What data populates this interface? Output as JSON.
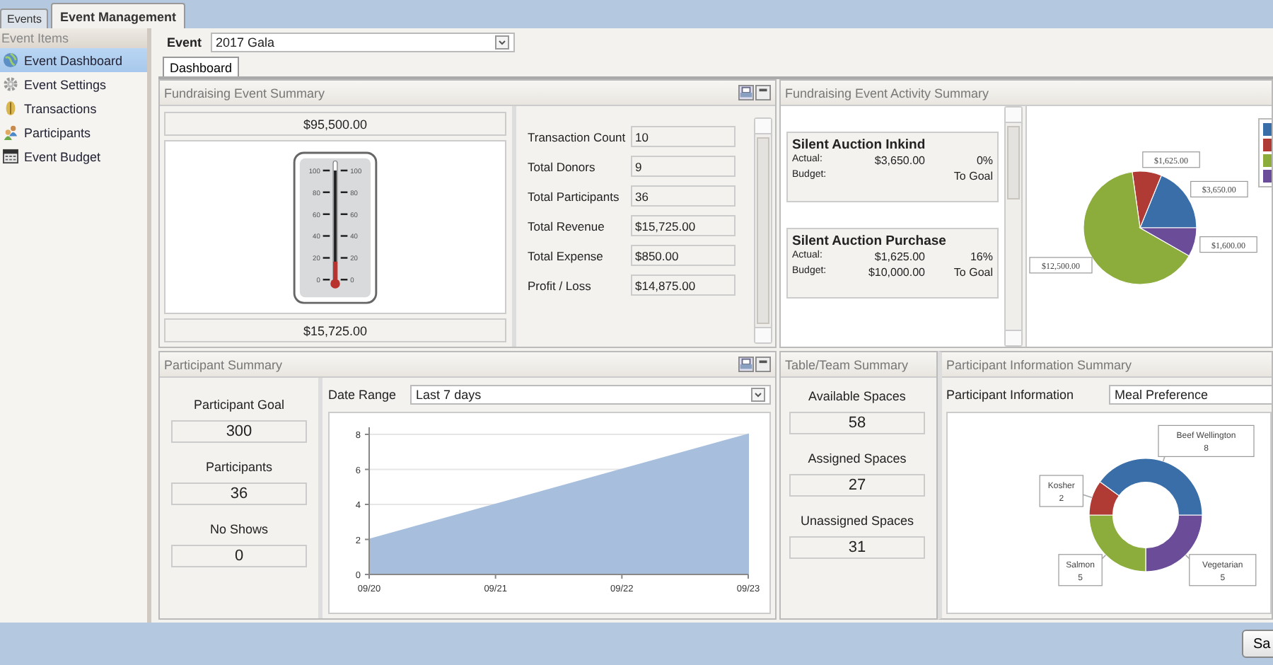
{
  "top_tabs": [
    {
      "label": "Events",
      "selected": false
    },
    {
      "label": "Event Management",
      "selected": true
    }
  ],
  "sidebar": {
    "title": "Event Items",
    "items": [
      {
        "label": "Event Dashboard",
        "kind": "globe",
        "selected": true
      },
      {
        "label": "Event Settings",
        "kind": "gear",
        "selected": false
      },
      {
        "label": "Transactions",
        "kind": "coin",
        "selected": false
      },
      {
        "label": "Participants",
        "kind": "people",
        "selected": false
      },
      {
        "label": "Event Budget",
        "kind": "calendar",
        "selected": false
      }
    ]
  },
  "event": {
    "label": "Event",
    "value": "2017 Gala"
  },
  "view_tabs": [
    {
      "label": "Dashboard",
      "selected": true
    }
  ],
  "fundraising_summary": {
    "title": "Fundraising Event Summary",
    "goal": "$95,500.00",
    "raised": "$15,725.00",
    "thermometer": {
      "level": 0.165,
      "left_ticks": [
        "100",
        "80",
        "60",
        "40",
        "20",
        "0"
      ],
      "right_ticks": [
        "100",
        "80",
        "60",
        "40",
        "20",
        "0"
      ]
    },
    "stats": [
      {
        "label": "Transaction Count",
        "value": "10"
      },
      {
        "label": "Total Donors",
        "value": "9"
      },
      {
        "label": "Total Participants",
        "value": "36"
      },
      {
        "label": "Total Revenue",
        "value": "$15,725.00"
      },
      {
        "label": "Total Expense",
        "value": "$850.00"
      },
      {
        "label": "Profit / Loss",
        "value": "$14,875.00"
      }
    ]
  },
  "activity_summary": {
    "title": "Fundraising Event Activity Summary",
    "cards": [
      {
        "title": "Silent Auction Inkind",
        "actual_label": "Actual:",
        "actual": "$3,650.00",
        "percent": "0%",
        "budget_label": "Budget:",
        "goal_label": "To Goal"
      },
      {
        "title": "Silent Auction Purchase",
        "actual_label": "Actual:",
        "actual": "$1,625.00",
        "percent": "16%",
        "budget_label": "Budget:",
        "budget": "$10,000.00",
        "goal_label": "To Goal"
      }
    ],
    "chart_data": {
      "type": "pie",
      "values": [
        3650,
        1625,
        12500,
        1600
      ],
      "value_labels": [
        "$3,650.00",
        "$1,625.00",
        "$12,500.00",
        "$1,600.00"
      ],
      "colors": [
        "#3a6ea8",
        "#b03a34",
        "#8cac3c",
        "#6a4c98"
      ],
      "data_labels": true
    }
  },
  "participant_summary": {
    "title": "Participant Summary",
    "stats": [
      {
        "label": "Participant Goal",
        "value": "300"
      },
      {
        "label": "Participants",
        "value": "36"
      },
      {
        "label": "No Shows",
        "value": "0"
      }
    ],
    "date_range": {
      "label": "Date Range",
      "value": "Last 7 days"
    },
    "chart_data": {
      "type": "area",
      "x": [
        "09/20",
        "09/21",
        "09/22",
        "09/23"
      ],
      "series": [
        {
          "color": "#a7bfdd",
          "values": [
            2,
            4,
            6,
            8
          ]
        }
      ],
      "ylim": [
        0,
        8
      ],
      "yticks": [
        0,
        2,
        4,
        6,
        8
      ],
      "grid": true
    }
  },
  "table_team_summary": {
    "title": "Table/Team Summary",
    "stats": [
      {
        "label": "Available Spaces",
        "value": "58"
      },
      {
        "label": "Assigned Spaces",
        "value": "27"
      },
      {
        "label": "Unassigned Spaces",
        "value": "31"
      }
    ]
  },
  "participant_information_summary": {
    "title": "Participant Information Summary",
    "field": {
      "label": "Participant Information",
      "value": "Meal Preference"
    },
    "chart_data": {
      "type": "donut",
      "categories": [
        "Vegetarian",
        "Salmon",
        "Kosher",
        "Beef Wellington"
      ],
      "values": [
        5,
        5,
        2,
        8
      ],
      "colors": [
        "#6a4c98",
        "#8cac3c",
        "#b03a34",
        "#3a6ea8"
      ],
      "data_labels": true
    }
  },
  "footer": {
    "button": "Sa"
  }
}
